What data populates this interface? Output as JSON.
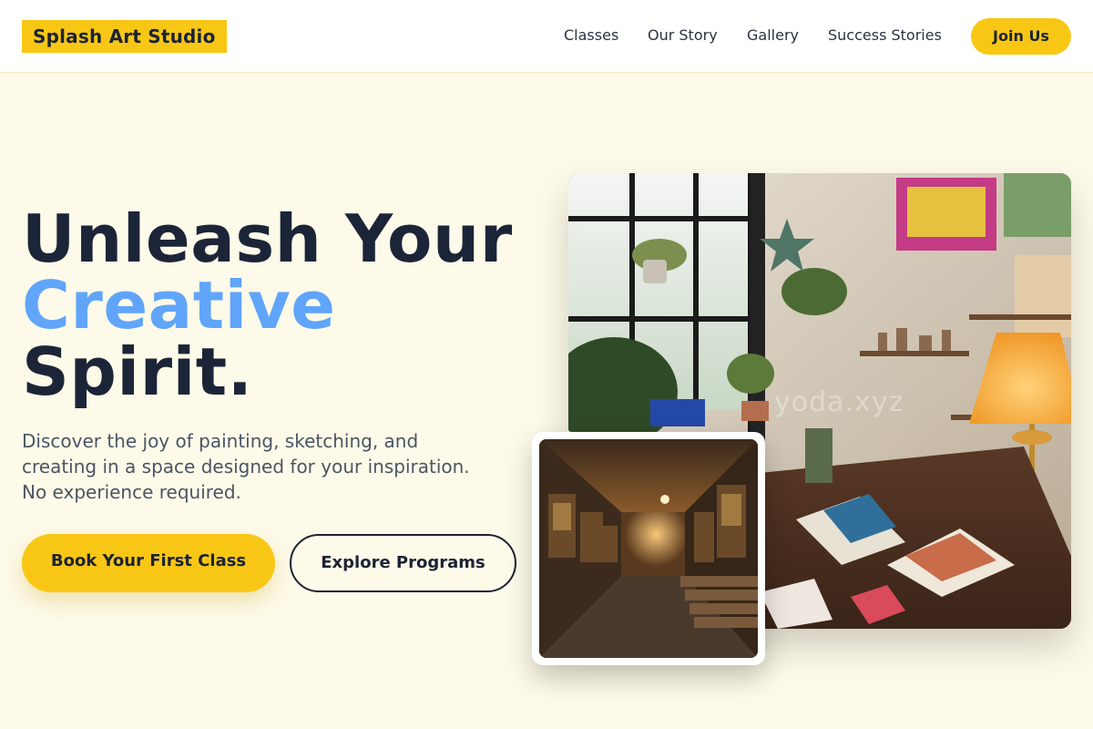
{
  "header": {
    "logo": "Splash Art Studio",
    "nav": [
      "Classes",
      "Our Story",
      "Gallery",
      "Success Stories"
    ],
    "cta": "Join Us"
  },
  "hero": {
    "headline_line1": "Unleash Your",
    "headline_accent": "Creative",
    "headline_line3": "Spirit.",
    "subtext_lines": [
      "Discover the joy of painting, sketching, and",
      "creating in a space designed for your inspiration.",
      "No experience required."
    ],
    "primary_button": "Book Your First Class",
    "secondary_button": "Explore Programs"
  },
  "images": {
    "main_watermark": "yoda.xyz"
  },
  "colors": {
    "accent_yellow": "#f8c716",
    "accent_blue": "#60a5fa",
    "text_dark": "#1c2538",
    "background": "#fdfae9"
  }
}
